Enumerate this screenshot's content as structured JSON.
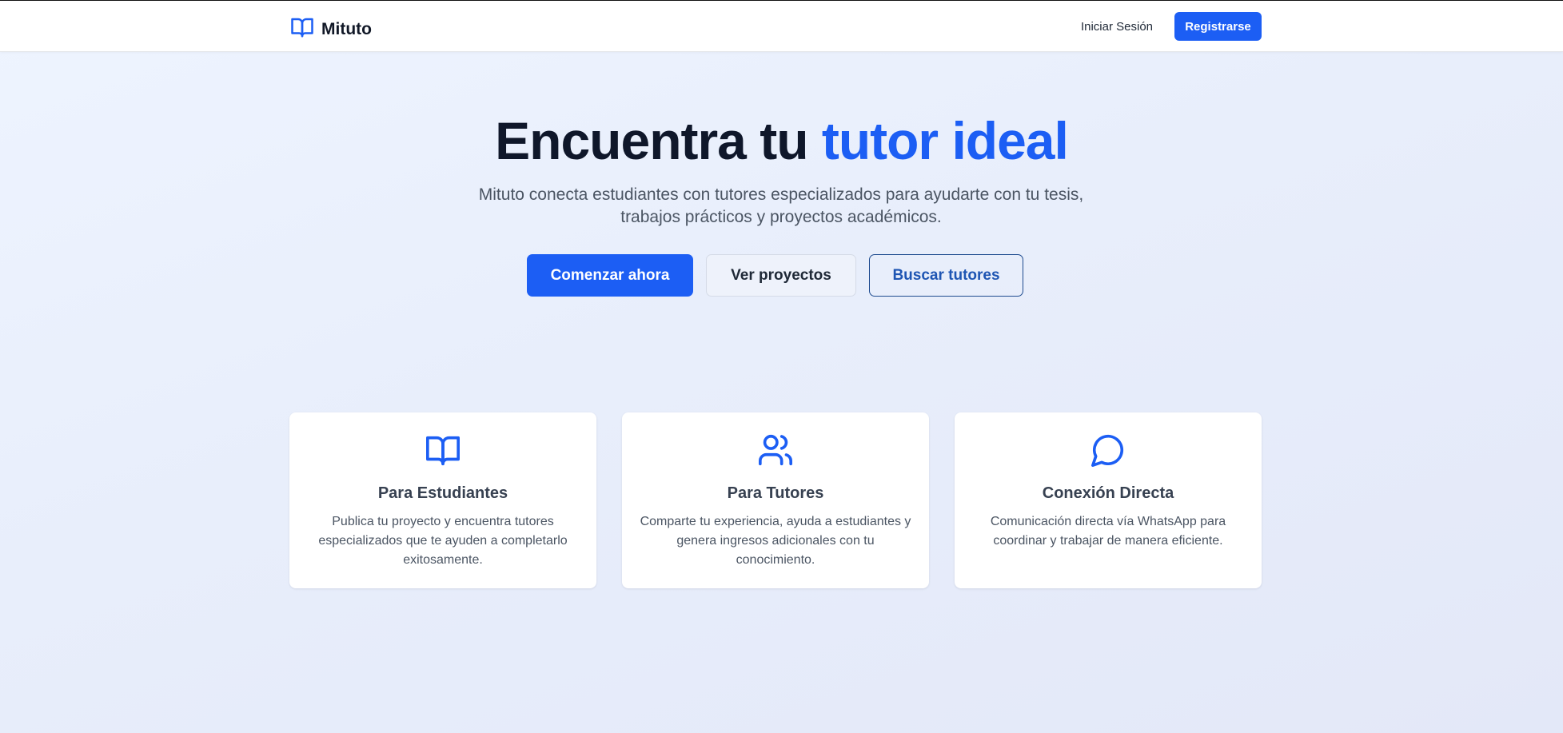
{
  "brand": {
    "name": "Mituto",
    "logo_icon": "book-open-icon"
  },
  "nav": {
    "login_label": "Iniciar Sesión",
    "register_label": "Registrarse"
  },
  "hero": {
    "title_main": "Encuentra tu ",
    "title_accent": "tutor ideal",
    "subtitle": "Mituto conecta estudiantes con tutores especializados para ayudarte con tu tesis, trabajos prácticos y proyectos académicos."
  },
  "actions": {
    "primary_label": "Comenzar ahora",
    "secondary_label": "Ver proyectos",
    "outline_label": "Buscar tutores"
  },
  "features": [
    {
      "icon": "book-open-icon",
      "title": "Para Estudiantes",
      "description": "Publica tu proyecto y encuentra tutores especializados que te ayuden a completarlo exitosamente."
    },
    {
      "icon": "users-icon",
      "title": "Para Tutores",
      "description": "Comparte tu experiencia, ayuda a estudiantes y genera ingresos adicionales con tu conocimiento."
    },
    {
      "icon": "message-circle-icon",
      "title": "Conexión Directa",
      "description": "Comunicación directa vía WhatsApp para coordinar y trabajar de manera eficiente."
    }
  ],
  "colors": {
    "accent": "#1c5ef4",
    "text_dark": "#0f172a",
    "text_muted": "#4b5563",
    "background": "#e8eefb"
  }
}
